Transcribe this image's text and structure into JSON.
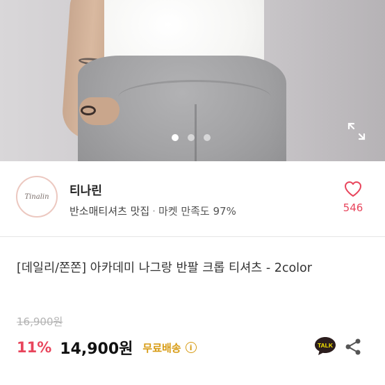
{
  "gallery": {
    "dots": [
      true,
      false,
      false
    ],
    "expand_icon": "expand-icon"
  },
  "seller": {
    "logo_text": "Tinalin",
    "name": "티나린",
    "tagline": "반소매티셔츠 맛집",
    "separator": "·",
    "satisfaction": "마켓 만족도 97%",
    "like_icon": "heart-icon",
    "like_count": "546"
  },
  "product": {
    "title": "[데일리/쫀쫀] 아카데미 나그랑 반팔 크롭 티셔츠 - 2color",
    "original_price": "16,900원",
    "discount": "11%",
    "price": "14,900원",
    "shipping": "무료배송",
    "info_icon": "info-icon",
    "talk_label": "TALK",
    "share_icon": "share-icon"
  },
  "colors": {
    "accent": "#e8455c",
    "shipping": "#d79b13",
    "talk_bg": "#2b1d1d"
  }
}
